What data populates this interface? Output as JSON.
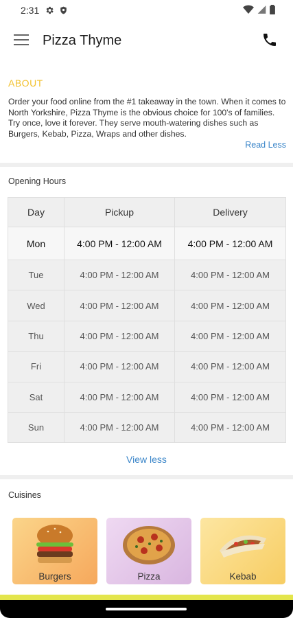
{
  "status_bar": {
    "time": "2:31"
  },
  "app_bar": {
    "title": "Pizza Thyme"
  },
  "about": {
    "title": "ABOUT",
    "text": "Order your food online from the #1 takeaway in the town. When it comes to North Yorkshire, Pizza Thyme is the obvious choice for 100's of families. Try once, love it forever. They serve mouth-watering dishes such as Burgers, Kebab, Pizza, Wraps and other dishes.",
    "read_less": "Read Less"
  },
  "opening_hours": {
    "title": "Opening Hours",
    "headers": {
      "day": "Day",
      "pickup": "Pickup",
      "delivery": "Delivery"
    },
    "rows": [
      {
        "day": "Mon",
        "pickup": "4:00 PM - 12:00 AM",
        "delivery": "4:00 PM - 12:00 AM"
      },
      {
        "day": "Tue",
        "pickup": "4:00 PM - 12:00 AM",
        "delivery": "4:00 PM - 12:00 AM"
      },
      {
        "day": "Wed",
        "pickup": "4:00 PM - 12:00 AM",
        "delivery": "4:00 PM - 12:00 AM"
      },
      {
        "day": "Thu",
        "pickup": "4:00 PM - 12:00 AM",
        "delivery": "4:00 PM - 12:00 AM"
      },
      {
        "day": "Fri",
        "pickup": "4:00 PM - 12:00 AM",
        "delivery": "4:00 PM - 12:00 AM"
      },
      {
        "day": "Sat",
        "pickup": "4:00 PM - 12:00 AM",
        "delivery": "4:00 PM - 12:00 AM"
      },
      {
        "day": "Sun",
        "pickup": "4:00 PM - 12:00 AM",
        "delivery": "4:00 PM - 12:00 AM"
      }
    ],
    "view_less": "View less"
  },
  "cuisines": {
    "title": "Cuisines",
    "items": [
      {
        "label": "Burgers",
        "icon": "burger-icon"
      },
      {
        "label": "Pizza",
        "icon": "pizza-icon"
      },
      {
        "label": "Kebab",
        "icon": "kebab-icon"
      }
    ]
  },
  "colors": {
    "accent": "#f2c12e",
    "link": "#3b86c9",
    "stripe": "#e3e54c"
  }
}
